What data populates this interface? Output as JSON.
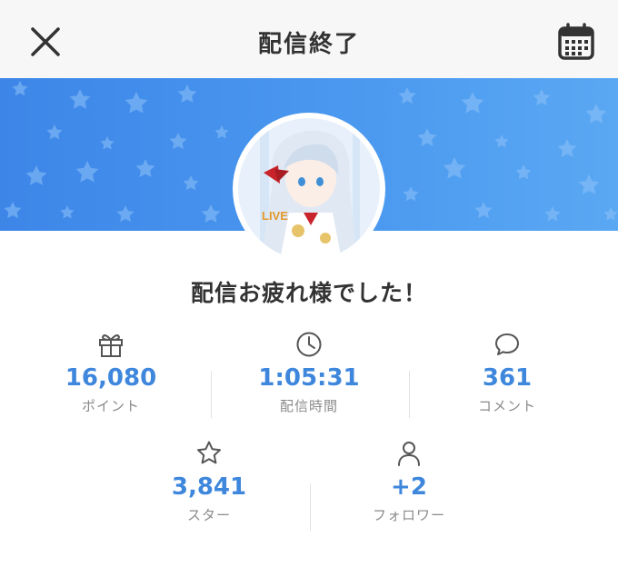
{
  "header": {
    "title": "配信終了",
    "close_icon": "close-icon",
    "calendar_icon": "calendar-icon"
  },
  "banner": {
    "color": "#4a98ef"
  },
  "profile": {
    "badge": "LIVE"
  },
  "summary": {
    "message": "配信お疲れ様でした！"
  },
  "stats": [
    {
      "icon": "gift-icon",
      "value": "16,080",
      "label": "ポイント"
    },
    {
      "icon": "clock-icon",
      "value": "1:05:31",
      "label": "配信時間"
    },
    {
      "icon": "comment-icon",
      "value": "361",
      "label": "コメント"
    },
    {
      "icon": "star-icon",
      "value": "3,841",
      "label": "スター"
    },
    {
      "icon": "person-icon",
      "value": "+2",
      "label": "フォロワー"
    }
  ],
  "colors": {
    "accent": "#3e87dc",
    "label": "#8a8a8a",
    "header_bg": "#f7f7f7"
  }
}
